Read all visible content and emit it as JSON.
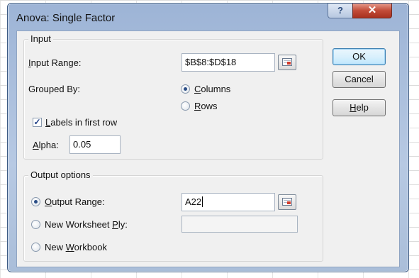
{
  "dialog": {
    "title": "Anova: Single Factor",
    "help_icon": "question-mark-icon",
    "close_icon": "close-x-icon"
  },
  "input_group": {
    "label": "Input",
    "input_range_label_u": "I",
    "input_range_label_rest": "nput Range:",
    "input_range_value": "$B$8:$D$18",
    "grouped_by_label": "Grouped By:",
    "columns_u": "C",
    "columns_rest": "olumns",
    "rows_u": "R",
    "rows_rest": "ows",
    "grouped_by_selected": "Columns",
    "labels_checkbox_u": "L",
    "labels_checkbox_rest": "abels in first row",
    "labels_checked": true,
    "alpha_label_u": "A",
    "alpha_label_rest": "lpha:",
    "alpha_value": "0.05"
  },
  "output_group": {
    "label": "Output options",
    "output_range_u": "O",
    "output_range_rest": "utput Range:",
    "output_range_value": "A22",
    "new_ply_pre": "New Worksheet ",
    "new_ply_u": "P",
    "new_ply_rest": "ly:",
    "new_ply_value": "",
    "new_workbook_pre": "New ",
    "new_workbook_u": "W",
    "new_workbook_rest": "orkbook",
    "selected": "Output Range"
  },
  "buttons": {
    "ok": "OK",
    "cancel": "Cancel",
    "help_u": "H",
    "help_rest": "elp"
  }
}
